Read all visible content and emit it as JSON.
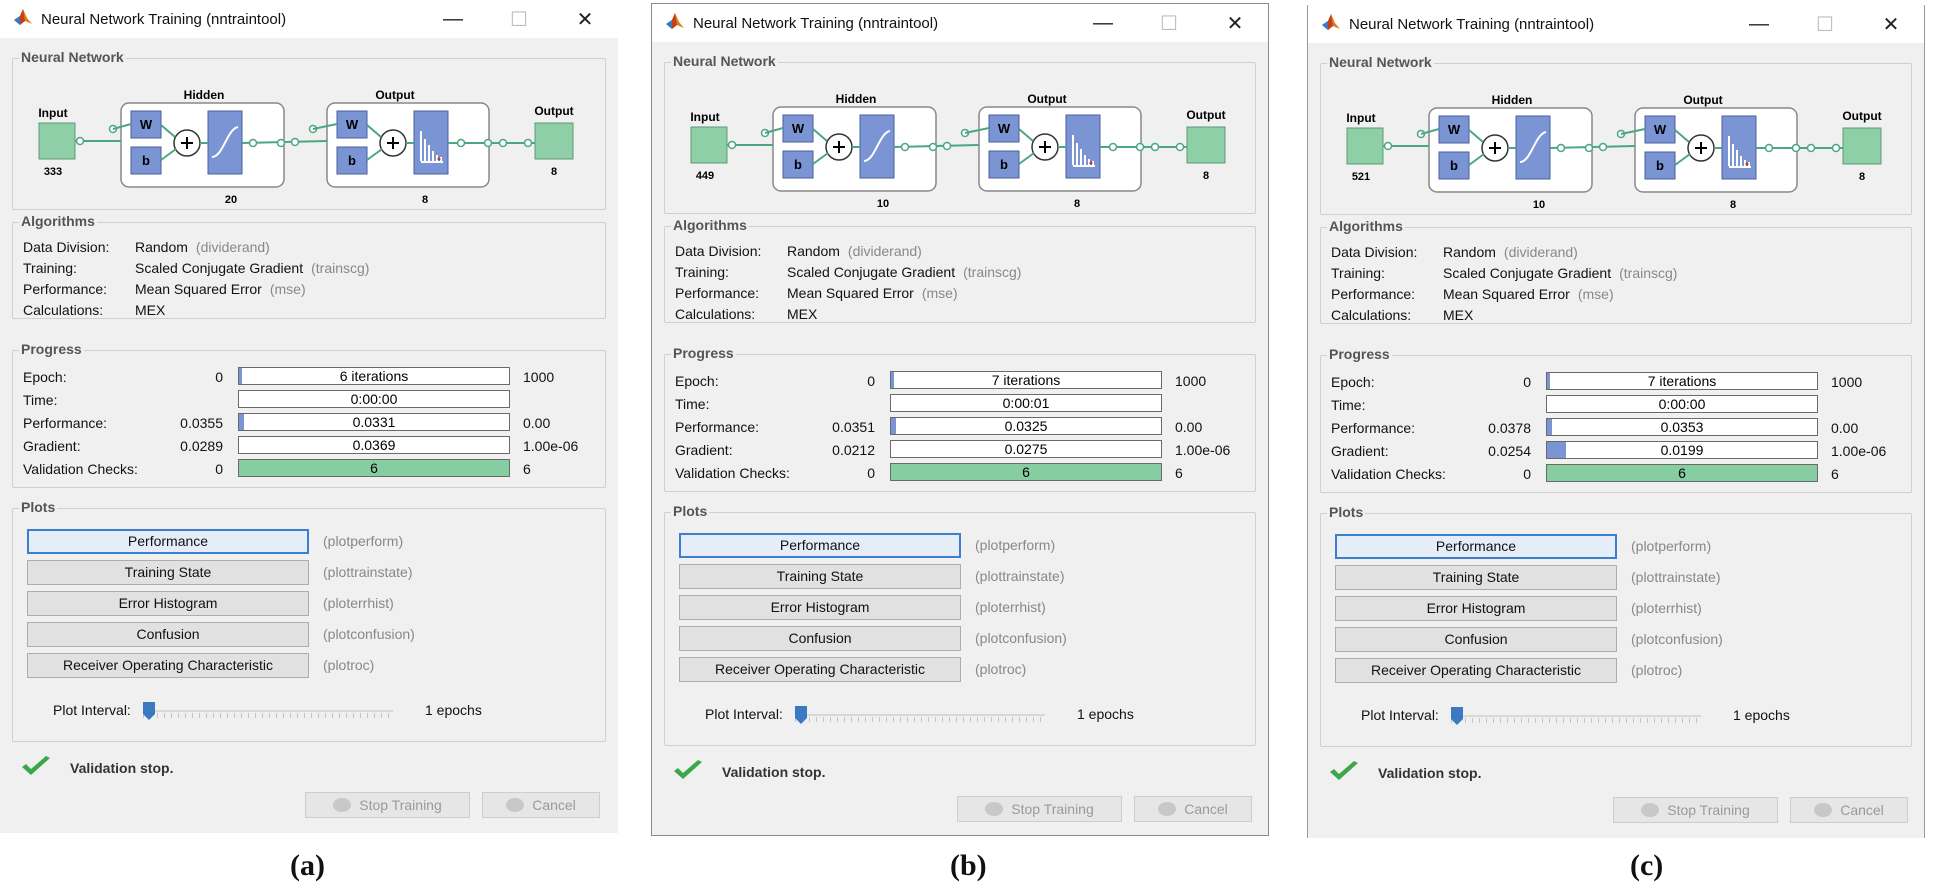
{
  "windows": [
    {
      "title": "Neural Network Training (nntraintool)",
      "sections": {
        "network": "Neural Network",
        "algorithms": "Algorithms",
        "progress": "Progress",
        "plots": "Plots"
      },
      "network": {
        "input_label": "Input",
        "input_size": "333",
        "hidden_label": "Hidden",
        "hidden_size": "20",
        "output_layer_label": "Output",
        "output_layer_size": "8",
        "output_label": "Output",
        "output_size": "8",
        "w": "W",
        "b": "b"
      },
      "algorithms": [
        {
          "label": "Data Division:",
          "value": "Random",
          "func": "(dividerand)"
        },
        {
          "label": "Training:",
          "value": "Scaled Conjugate Gradient",
          "func": "(trainscg)"
        },
        {
          "label": "Performance:",
          "value": "Mean Squared Error",
          "func": "(mse)"
        },
        {
          "label": "Calculations:",
          "value": "MEX",
          "func": ""
        }
      ],
      "progress": [
        {
          "label": "Epoch:",
          "low": "0",
          "current": "6 iterations",
          "high": "1000",
          "fill": 0.01,
          "color": "#7b94d4"
        },
        {
          "label": "Time:",
          "low": "",
          "current": "0:00:00",
          "high": "",
          "fill": 0,
          "color": "#7b94d4"
        },
        {
          "label": "Performance:",
          "low": "0.0355",
          "current": "0.0331",
          "high": "0.00",
          "fill": 0.02,
          "color": "#7b94d4"
        },
        {
          "label": "Gradient:",
          "low": "0.0289",
          "current": "0.0369",
          "high": "1.00e-06",
          "fill": 0,
          "color": "#7b94d4"
        },
        {
          "label": "Validation Checks:",
          "low": "0",
          "current": "6",
          "high": "6",
          "fill": 1,
          "color": "#86cda2"
        }
      ],
      "plots": [
        {
          "label": "Performance",
          "func": "(plotperform)"
        },
        {
          "label": "Training State",
          "func": "(plottrainstate)"
        },
        {
          "label": "Error Histogram",
          "func": "(ploterrhist)"
        },
        {
          "label": "Confusion",
          "func": "(plotconfusion)"
        },
        {
          "label": "Receiver Operating Characteristic",
          "func": "(plotroc)"
        }
      ],
      "plot_interval": {
        "label": "Plot Interval:",
        "value": "1 epochs"
      },
      "status": "Validation stop.",
      "buttons": {
        "stop": "Stop Training",
        "cancel": "Cancel"
      },
      "caption": "(a)"
    },
    {
      "title": "Neural Network Training (nntraintool)",
      "sections": {
        "network": "Neural Network",
        "algorithms": "Algorithms",
        "progress": "Progress",
        "plots": "Plots"
      },
      "network": {
        "input_label": "Input",
        "input_size": "449",
        "hidden_label": "Hidden",
        "hidden_size": "10",
        "output_layer_label": "Output",
        "output_layer_size": "8",
        "output_label": "Output",
        "output_size": "8",
        "w": "W",
        "b": "b"
      },
      "algorithms": [
        {
          "label": "Data Division:",
          "value": "Random",
          "func": "(dividerand)"
        },
        {
          "label": "Training:",
          "value": "Scaled Conjugate Gradient",
          "func": "(trainscg)"
        },
        {
          "label": "Performance:",
          "value": "Mean Squared Error",
          "func": "(mse)"
        },
        {
          "label": "Calculations:",
          "value": "MEX",
          "func": ""
        }
      ],
      "progress": [
        {
          "label": "Epoch:",
          "low": "0",
          "current": "7 iterations",
          "high": "1000",
          "fill": 0.01,
          "color": "#7b94d4"
        },
        {
          "label": "Time:",
          "low": "",
          "current": "0:00:01",
          "high": "",
          "fill": 0,
          "color": "#7b94d4"
        },
        {
          "label": "Performance:",
          "low": "0.0351",
          "current": "0.0325",
          "high": "0.00",
          "fill": 0.02,
          "color": "#7b94d4"
        },
        {
          "label": "Gradient:",
          "low": "0.0212",
          "current": "0.0275",
          "high": "1.00e-06",
          "fill": 0,
          "color": "#7b94d4"
        },
        {
          "label": "Validation Checks:",
          "low": "0",
          "current": "6",
          "high": "6",
          "fill": 1,
          "color": "#86cda2"
        }
      ],
      "plots": [
        {
          "label": "Performance",
          "func": "(plotperform)"
        },
        {
          "label": "Training State",
          "func": "(plottrainstate)"
        },
        {
          "label": "Error Histogram",
          "func": "(ploterrhist)"
        },
        {
          "label": "Confusion",
          "func": "(plotconfusion)"
        },
        {
          "label": "Receiver Operating Characteristic",
          "func": "(plotroc)"
        }
      ],
      "plot_interval": {
        "label": "Plot Interval:",
        "value": "1 epochs"
      },
      "status": "Validation stop.",
      "buttons": {
        "stop": "Stop Training",
        "cancel": "Cancel"
      },
      "caption": "(b)"
    },
    {
      "title": "Neural Network Training (nntraintool)",
      "sections": {
        "network": "Neural Network",
        "algorithms": "Algorithms",
        "progress": "Progress",
        "plots": "Plots"
      },
      "network": {
        "input_label": "Input",
        "input_size": "521",
        "hidden_label": "Hidden",
        "hidden_size": "10",
        "output_layer_label": "Output",
        "output_layer_size": "8",
        "output_label": "Output",
        "output_size": "8",
        "w": "W",
        "b": "b"
      },
      "algorithms": [
        {
          "label": "Data Division:",
          "value": "Random",
          "func": "(dividerand)"
        },
        {
          "label": "Training:",
          "value": "Scaled Conjugate Gradient",
          "func": "(trainscg)"
        },
        {
          "label": "Performance:",
          "value": "Mean Squared Error",
          "func": "(mse)"
        },
        {
          "label": "Calculations:",
          "value": "MEX",
          "func": ""
        }
      ],
      "progress": [
        {
          "label": "Epoch:",
          "low": "0",
          "current": "7 iterations",
          "high": "1000",
          "fill": 0.01,
          "color": "#7b94d4"
        },
        {
          "label": "Time:",
          "low": "",
          "current": "0:00:00",
          "high": "",
          "fill": 0,
          "color": "#7b94d4"
        },
        {
          "label": "Performance:",
          "low": "0.0378",
          "current": "0.0353",
          "high": "0.00",
          "fill": 0.02,
          "color": "#7b94d4"
        },
        {
          "label": "Gradient:",
          "low": "0.0254",
          "current": "0.0199",
          "high": "1.00e-06",
          "fill": 0.07,
          "color": "#7b94d4"
        },
        {
          "label": "Validation Checks:",
          "low": "0",
          "current": "6",
          "high": "6",
          "fill": 1,
          "color": "#86cda2"
        }
      ],
      "plots": [
        {
          "label": "Performance",
          "func": "(plotperform)"
        },
        {
          "label": "Training State",
          "func": "(plottrainstate)"
        },
        {
          "label": "Error Histogram",
          "func": "(ploterrhist)"
        },
        {
          "label": "Confusion",
          "func": "(plotconfusion)"
        },
        {
          "label": "Receiver Operating Characteristic",
          "func": "(plotroc)"
        }
      ],
      "plot_interval": {
        "label": "Plot Interval:",
        "value": "1 epochs"
      },
      "status": "Validation stop.",
      "buttons": {
        "stop": "Stop Training",
        "cancel": "Cancel"
      },
      "caption": "(c)"
    }
  ]
}
